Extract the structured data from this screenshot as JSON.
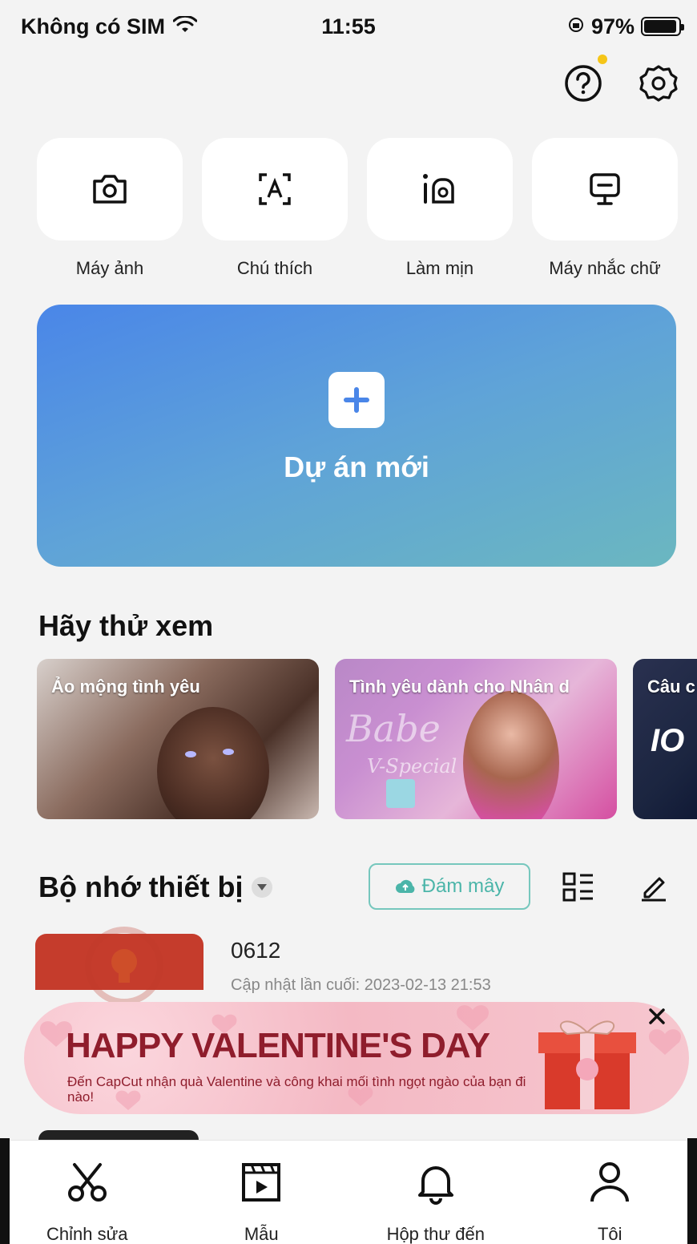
{
  "status_bar": {
    "carrier": "Không có SIM",
    "time": "11:55",
    "battery": "97%"
  },
  "tools": [
    {
      "label": "Máy ảnh",
      "icon": "camera-icon"
    },
    {
      "label": "Chú thích",
      "icon": "auto-caption-icon"
    },
    {
      "label": "Làm mịn",
      "icon": "retouch-icon"
    },
    {
      "label": "Máy nhắc chữ",
      "icon": "teleprompter-icon"
    }
  ],
  "new_project": {
    "label": "Dự án mới"
  },
  "try_section": {
    "title": "Hãy thử xem",
    "cards": [
      {
        "title": "Ảo mộng tình yêu"
      },
      {
        "title": "Tình yêu dành cho Nhân d",
        "art_text": "Babe",
        "art_text_2": "V-Special"
      },
      {
        "title": "Câu c",
        "art_text": "IO"
      }
    ]
  },
  "storage": {
    "title": "Bộ nhớ thiết bị",
    "cloud_label": "Đám mây",
    "project": {
      "name": "0612",
      "date": "Cập nhật lần cuối: 2023-02-13 21:53"
    }
  },
  "banner": {
    "title": "HAPPY VALENTINE'S DAY",
    "subtitle": "Đến CapCut nhận quà Valentine và công khai mối tình ngọt ngào của bạn đi nào!"
  },
  "tabbar": [
    {
      "label": "Chỉnh sửa",
      "icon": "scissors-icon"
    },
    {
      "label": "Mẫu",
      "icon": "template-icon"
    },
    {
      "label": "Hộp thư đến",
      "icon": "bell-icon"
    },
    {
      "label": "Tôi",
      "icon": "profile-icon"
    }
  ],
  "colors": {
    "accent_blue": "#4a86e8",
    "teal": "#4bb5a9",
    "valentine_red": "#8f1d2c"
  }
}
